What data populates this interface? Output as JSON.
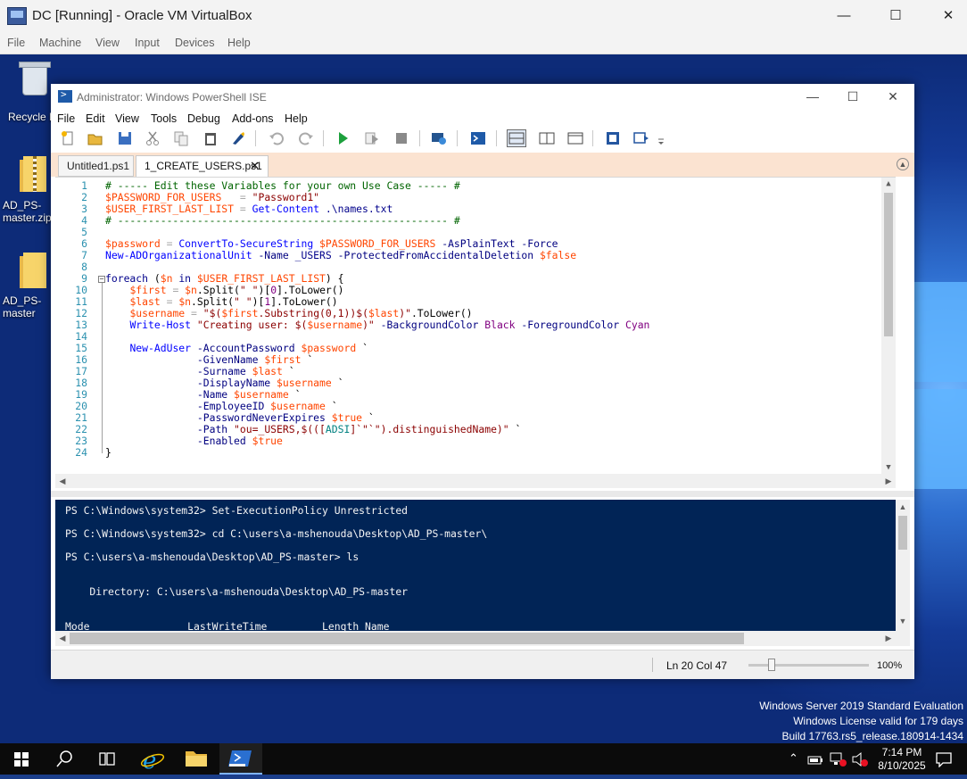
{
  "vbox": {
    "title": "DC [Running] - Oracle VM VirtualBox",
    "controls": {
      "minimize": "—",
      "maximize": "☐",
      "close": "✕"
    },
    "menu": [
      "File",
      "Machine",
      "View",
      "Input",
      "Devices",
      "Help"
    ]
  },
  "desktop": {
    "icons": [
      {
        "label": "Recycle Bin",
        "kind": "recycle-bin"
      },
      {
        "label": "AD_PS-master.zip",
        "kind": "zip-folder"
      },
      {
        "label": "AD_PS-master",
        "kind": "folder"
      }
    ],
    "watermark": [
      "Windows Server 2019 Standard Evaluation",
      "Windows License valid for 179 days",
      "Build 17763.rs5_release.180914-1434"
    ]
  },
  "ise": {
    "title": "Administrator: Windows PowerShell ISE",
    "controls": {
      "minimize": "—",
      "maximize": "☐",
      "close": "✕"
    },
    "menu": [
      "File",
      "Edit",
      "View",
      "Tools",
      "Debug",
      "Add-ons",
      "Help"
    ],
    "toolbar": [
      "new-script",
      "open",
      "save",
      "cut",
      "copy",
      "paste",
      "clear-console",
      "undo",
      "redo",
      "run-script",
      "run-selection",
      "stop",
      "new-remote-tab",
      "start-powershell",
      "show-script-pane-top",
      "show-script-pane-right",
      "show-script-pane-max",
      "show-command-window",
      "show-command-addon",
      "customize"
    ],
    "tabs": [
      {
        "label": "Untitled1.ps1",
        "active": false
      },
      {
        "label": "1_CREATE_USERS.ps1",
        "active": true,
        "close": "✕"
      }
    ],
    "script": [
      {
        "n": "1",
        "text": "# ----- Edit these Variables for your own Use Case ----- #"
      },
      {
        "n": "2",
        "text": "$PASSWORD_FOR_USERS   = \"Password1\""
      },
      {
        "n": "3",
        "text": "$USER_FIRST_LAST_LIST = Get-Content .\\names.txt"
      },
      {
        "n": "4",
        "text": "# ------------------------------------------------------ #"
      },
      {
        "n": "5",
        "text": ""
      },
      {
        "n": "6",
        "text": "$password = ConvertTo-SecureString $PASSWORD_FOR_USERS -AsPlainText -Force"
      },
      {
        "n": "7",
        "text": "New-ADOrganizationalUnit -Name _USERS -ProtectedFromAccidentalDeletion $false"
      },
      {
        "n": "8",
        "text": ""
      },
      {
        "n": "9",
        "text": "foreach ($n in $USER_FIRST_LAST_LIST) {"
      },
      {
        "n": "10",
        "text": "    $first = $n.Split(\" \")[0].ToLower()"
      },
      {
        "n": "11",
        "text": "    $last = $n.Split(\" \")[1].ToLower()"
      },
      {
        "n": "12",
        "text": "    $username = \"$($first.Substring(0,1))$($last)\".ToLower()"
      },
      {
        "n": "13",
        "text": "    Write-Host \"Creating user: $($username)\" -BackgroundColor Black -ForegroundColor Cyan"
      },
      {
        "n": "14",
        "text": ""
      },
      {
        "n": "15",
        "text": "    New-AdUser -AccountPassword $password `"
      },
      {
        "n": "16",
        "text": "               -GivenName $first `"
      },
      {
        "n": "17",
        "text": "               -Surname $last `"
      },
      {
        "n": "18",
        "text": "               -DisplayName $username `"
      },
      {
        "n": "19",
        "text": "               -Name $username `"
      },
      {
        "n": "20",
        "text": "               -EmployeeID $username `"
      },
      {
        "n": "21",
        "text": "               -PasswordNeverExpires $true `"
      },
      {
        "n": "22",
        "text": "               -Path \"ou=_USERS,$(([ADSI]`\"\").distinguishedName)\" `"
      },
      {
        "n": "23",
        "text": "               -Enabled $true"
      },
      {
        "n": "24",
        "text": "}"
      }
    ],
    "console": [
      "PS C:\\Windows\\system32> Set-ExecutionPolicy Unrestricted",
      "",
      "PS C:\\Windows\\system32> cd C:\\users\\a-mshenouda\\Desktop\\AD_PS-master\\",
      "",
      "PS C:\\users\\a-mshenouda\\Desktop\\AD_PS-master> ls",
      "",
      "",
      "    Directory: C:\\users\\a-mshenouda\\Desktop\\AD_PS-master",
      "",
      "",
      "Mode                LastWriteTime         Length Name"
    ],
    "status": {
      "position": "Ln 20  Col 47",
      "zoom": "100%",
      "zoom_level": 0.17
    }
  },
  "taskbar": {
    "items": [
      "start",
      "search",
      "task-view",
      "internet-explorer",
      "file-explorer",
      "powershell-ise"
    ],
    "tray": [
      "show-hidden-icons",
      "battery-icon",
      "network-icon",
      "volume-muted-icon"
    ],
    "time": "7:14 PM",
    "date": "8/10/2025",
    "notifications": "action-center"
  },
  "colors": {
    "console_bg": "#012456",
    "tab_strip": "#fbe3d1",
    "comment": "#006400",
    "variable": "#ff4500",
    "string": "#8b0000",
    "command": "#0000ff",
    "parameter": "#000080",
    "keyword": "#00008b",
    "line_number": "#2b91af"
  }
}
